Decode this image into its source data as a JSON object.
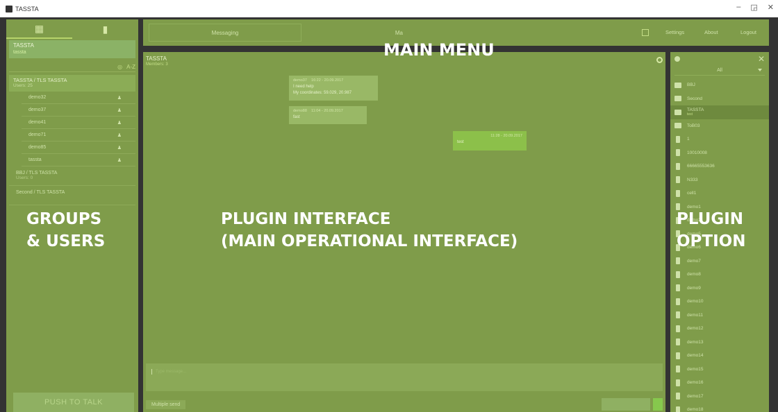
{
  "window": {
    "title": "TASSTA",
    "minimize": "–",
    "restore": "◲",
    "close": "✕"
  },
  "left_panel": {
    "tab_groups_icon": "groups-icon",
    "tab_device_icon": "device-icon",
    "current_user": {
      "name": "TASSTA",
      "sub": "tassta"
    },
    "sort_label": "A-Z",
    "groups": [
      {
        "name": "TASSTA / TLS TASSTA",
        "sub": "Users: 25"
      }
    ],
    "users": [
      "demo32",
      "demo37",
      "demo41",
      "demo71",
      "demo85",
      "tassta"
    ],
    "other_groups": [
      {
        "name": "BBJ / TLS TASSTA",
        "sub": "Users: 0"
      },
      {
        "name": "Second / TLS TASSTA",
        "sub": ""
      }
    ],
    "push_to_talk": "PUSH TO TALK"
  },
  "top_menu": {
    "tab_messaging": "Messaging",
    "tab_second": "Ma",
    "items": [
      "Settings",
      "About",
      "Logout"
    ]
  },
  "plugin": {
    "header_title": "TASSTA",
    "header_sub": "Members: 3",
    "messages": [
      {
        "sender": "demo37",
        "time": "16:22 - 20.09.2017",
        "text": "I need help\nMy coordinates: 59.029, 20.987"
      },
      {
        "sender": "demo88",
        "time": "11:04 - 20.09.2017",
        "text": "fast"
      },
      {
        "sender": "",
        "time": "11:28 - 20.09.2017",
        "text": "test"
      }
    ],
    "composer_placeholder": "Type message...",
    "multiple_send": "Multiple send"
  },
  "right_panel": {
    "filter": "All",
    "items": [
      {
        "label": "BBJ",
        "sub": "",
        "kind": "group"
      },
      {
        "label": "Second",
        "sub": "",
        "kind": "group"
      },
      {
        "label": "TASSTA",
        "sub": "test",
        "kind": "group",
        "selected": true
      },
      {
        "label": "ToB03",
        "sub": "",
        "kind": "group"
      },
      {
        "label": "1",
        "sub": "",
        "kind": "device"
      },
      {
        "label": "10010008",
        "sub": "",
        "kind": "device"
      },
      {
        "label": "66665553636",
        "sub": "",
        "kind": "device"
      },
      {
        "label": "N333",
        "sub": "",
        "kind": "device"
      },
      {
        "label": "cell1",
        "sub": "",
        "kind": "device"
      },
      {
        "label": "demo1",
        "sub": "",
        "kind": "device"
      },
      {
        "label": "demo2",
        "sub": "",
        "kind": "device"
      },
      {
        "label": "demo5",
        "sub": "",
        "kind": "device"
      },
      {
        "label": "demo6",
        "sub": "",
        "kind": "device"
      },
      {
        "label": "demo7",
        "sub": "",
        "kind": "device"
      },
      {
        "label": "demo8",
        "sub": "",
        "kind": "device"
      },
      {
        "label": "demo9",
        "sub": "",
        "kind": "device"
      },
      {
        "label": "demo10",
        "sub": "",
        "kind": "device"
      },
      {
        "label": "demo11",
        "sub": "",
        "kind": "device"
      },
      {
        "label": "demo12",
        "sub": "",
        "kind": "device"
      },
      {
        "label": "demo13",
        "sub": "",
        "kind": "device"
      },
      {
        "label": "demo14",
        "sub": "",
        "kind": "device"
      },
      {
        "label": "demo15",
        "sub": "",
        "kind": "device"
      },
      {
        "label": "demo16",
        "sub": "",
        "kind": "device"
      },
      {
        "label": "demo17",
        "sub": "",
        "kind": "device"
      },
      {
        "label": "demo18",
        "sub": "",
        "kind": "device"
      }
    ]
  },
  "overlay_labels": {
    "main_menu": "MAIN MENU",
    "groups_users_line1": "GROUPS",
    "groups_users_line2": "& USERS",
    "plugin_interface_line1": "PLUGIN INTERFACE",
    "plugin_interface_line2": "(MAIN OPERATIONAL INTERFACE)",
    "plugin_option_line1": "PLUGIN",
    "plugin_option_line2": "OPTION"
  },
  "colors": {
    "panel": "#7f9c4a",
    "frame": "#333333",
    "accent": "#8cc04a"
  }
}
